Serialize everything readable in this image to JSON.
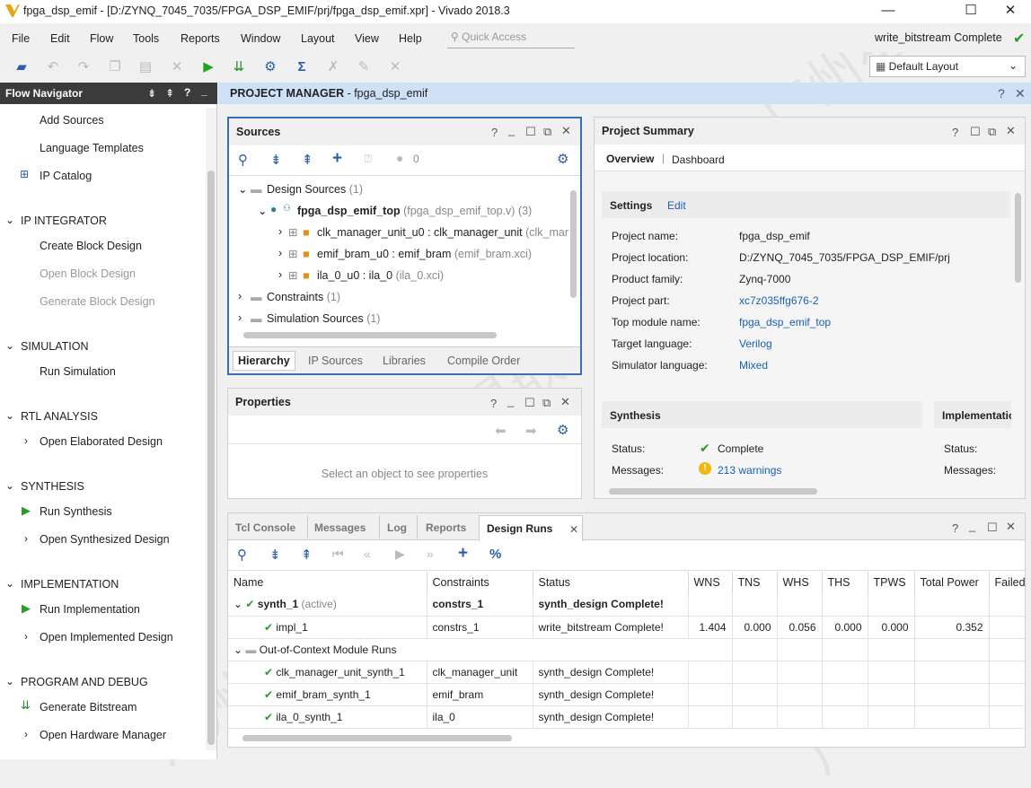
{
  "window": {
    "title": "fpga_dsp_emif - [D:/ZYNQ_7045_7035/FPGA_DSP_EMIF/prj/fpga_dsp_emif.xpr] - Vivado 2018.3",
    "minimize": "—",
    "maximize": "☐",
    "close": "✕"
  },
  "menu": {
    "items": [
      "File",
      "Edit",
      "Flow",
      "Tools",
      "Reports",
      "Window",
      "Layout",
      "View",
      "Help"
    ],
    "quick_access_placeholder": "Quick Access",
    "run_status": "write_bitstream Complete"
  },
  "toolbar": {
    "layout_select": "Default Layout"
  },
  "flow_navigator": {
    "title": "Flow Navigator",
    "items": {
      "add_sources": "Add Sources",
      "language_templates": "Language Templates",
      "ip_catalog": "IP Catalog",
      "ip_integrator": "IP INTEGRATOR",
      "create_block_design": "Create Block Design",
      "open_block_design": "Open Block Design",
      "generate_block_design": "Generate Block Design",
      "simulation": "SIMULATION",
      "run_simulation": "Run Simulation",
      "rtl_analysis": "RTL ANALYSIS",
      "open_elaborated_design": "Open Elaborated Design",
      "synthesis": "SYNTHESIS",
      "run_synthesis": "Run Synthesis",
      "open_synthesized_design": "Open Synthesized Design",
      "implementation": "IMPLEMENTATION",
      "run_implementation": "Run Implementation",
      "open_implemented_design": "Open Implemented Design",
      "program_and_debug": "PROGRAM AND DEBUG",
      "generate_bitstream": "Generate Bitstream",
      "open_hardware_manager": "Open Hardware Manager"
    }
  },
  "project_manager": {
    "title_bold": "PROJECT MANAGER",
    "title_rest": " - fpga_dsp_emif"
  },
  "sources": {
    "title": "Sources",
    "count_badge": "0",
    "tree": {
      "design_sources": "Design Sources",
      "design_sources_count": "(1)",
      "top": "fpga_dsp_emif_top",
      "top_file": "(fpga_dsp_emif_top.v) (3)",
      "child1": "clk_manager_unit_u0 : clk_manager_unit",
      "child1_file": "(clk_mar",
      "child2": "emif_bram_u0 : emif_bram",
      "child2_file": "(emif_bram.xci)",
      "child3": "ila_0_u0 : ila_0",
      "child3_file": "(ila_0.xci)",
      "constraints": "Constraints",
      "constraints_count": "(1)",
      "sim_sources": "Simulation Sources",
      "sim_sources_count": "(1)"
    },
    "tabs": [
      "Hierarchy",
      "IP Sources",
      "Libraries",
      "Compile Order"
    ]
  },
  "properties": {
    "title": "Properties",
    "empty_msg": "Select an object to see properties"
  },
  "summary": {
    "title": "Project Summary",
    "tabs": [
      "Overview",
      "Dashboard"
    ],
    "settings_label": "Settings",
    "edit_link": "Edit",
    "rows": [
      {
        "label": "Project name:",
        "value": "fpga_dsp_emif"
      },
      {
        "label": "Project location:",
        "value": "D:/ZYNQ_7045_7035/FPGA_DSP_EMIF/prj"
      },
      {
        "label": "Product family:",
        "value": "Zynq-7000"
      },
      {
        "label": "Project part:",
        "value": "xc7z035ffg676-2"
      },
      {
        "label": "Top module name:",
        "value": "fpga_dsp_emif_top"
      },
      {
        "label": "Target language:",
        "value": "Verilog"
      },
      {
        "label": "Simulator language:",
        "value": "Mixed"
      }
    ],
    "synthesis_label": "Synthesis",
    "implementation_label": "Implementation",
    "status_label": "Status:",
    "status_value": "Complete",
    "messages_label": "Messages:",
    "messages_value": "213 warnings",
    "impl_status_label": "Status:",
    "impl_messages_label": "Messages:"
  },
  "bottom": {
    "tabs": [
      "Tcl Console",
      "Messages",
      "Log",
      "Reports",
      "Design Runs"
    ],
    "columns": [
      "Name",
      "Constraints",
      "Status",
      "WNS",
      "TNS",
      "WHS",
      "THS",
      "TPWS",
      "Total Power",
      "Failed"
    ],
    "synth_name": "synth_1",
    "synth_active": "(active)",
    "synth_constr": "constrs_1",
    "synth_status": "synth_design Complete!",
    "impl": {
      "name": "impl_1",
      "constr": "constrs_1",
      "status": "write_bitstream Complete!",
      "wns": "1.404",
      "tns": "0.000",
      "whs": "0.056",
      "ths": "0.000",
      "tpws": "0.000",
      "power": "0.352"
    },
    "ooc_label": "Out-of-Context Module Runs",
    "ooc": [
      {
        "name": "clk_manager_unit_synth_1",
        "constr": "clk_manager_unit",
        "status": "synth_design Complete!"
      },
      {
        "name": "emif_bram_synth_1",
        "constr": "emif_bram",
        "status": "synth_design Complete!"
      },
      {
        "name": "ila_0_synth_1",
        "constr": "ila_0",
        "status": "synth_design Complete!"
      }
    ]
  },
  "watermark": "广州星嵌",
  "colors": {
    "accent_blue": "#1a5fb4",
    "check_green": "#2a9a2a",
    "pm_header": "#cfe1f7",
    "selected_border": "#3a6fb0"
  }
}
